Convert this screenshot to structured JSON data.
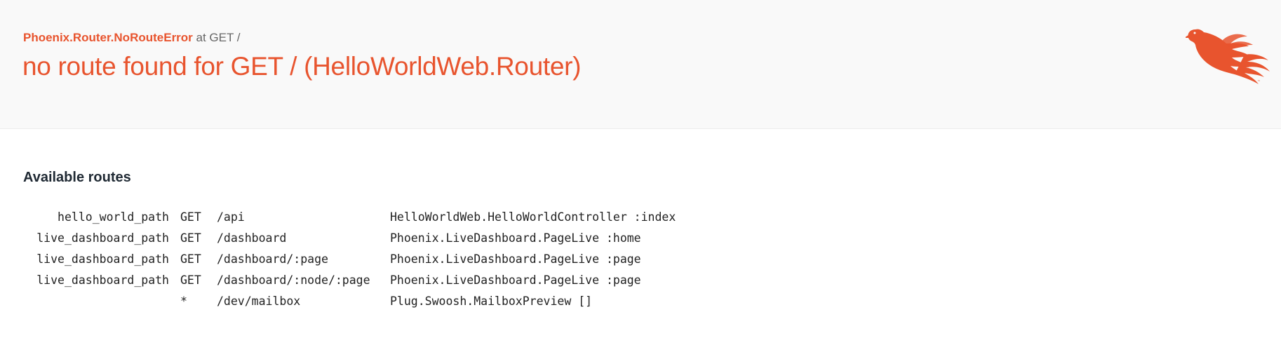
{
  "header": {
    "exception_name": "Phoenix.Router.NoRouteError",
    "request_info": " at GET /",
    "title": "no route found for GET / (HelloWorldWeb.Router)"
  },
  "logo": {
    "icon": "phoenix-logo-icon",
    "color": "#e8542e"
  },
  "routes_section": {
    "heading": "Available routes",
    "rows": [
      {
        "helper": "hello_world_path",
        "verb": "GET",
        "path": "/api",
        "plug": "HelloWorldWeb.HelloWorldController :index"
      },
      {
        "helper": "live_dashboard_path",
        "verb": "GET",
        "path": "/dashboard",
        "plug": "Phoenix.LiveDashboard.PageLive :home"
      },
      {
        "helper": "live_dashboard_path",
        "verb": "GET",
        "path": "/dashboard/:page",
        "plug": "Phoenix.LiveDashboard.PageLive :page"
      },
      {
        "helper": "live_dashboard_path",
        "verb": "GET",
        "path": "/dashboard/:node/:page",
        "plug": "Phoenix.LiveDashboard.PageLive :page"
      },
      {
        "helper": "",
        "verb": "*",
        "path": "/dev/mailbox",
        "plug": "Plug.Swoosh.MailboxPreview []"
      }
    ]
  },
  "colors": {
    "accent": "#e8542e",
    "header_bg": "#f9f9f9",
    "heading_text": "#1f2933"
  }
}
